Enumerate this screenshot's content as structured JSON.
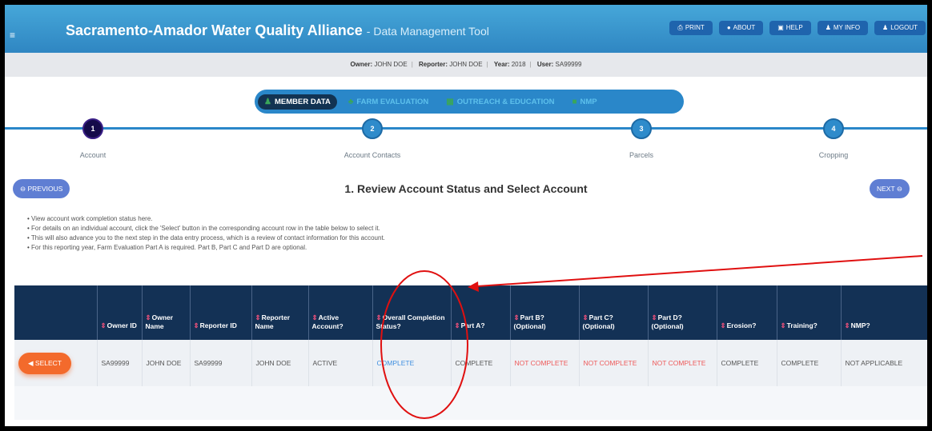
{
  "app": {
    "title": "Sacramento-Amador Water Quality Alliance",
    "subtitle": "- Data Management Tool",
    "menu_icon": "menu-icon",
    "buttons": [
      {
        "label": "PRINT",
        "icon": "printer-icon"
      },
      {
        "label": "ABOUT",
        "icon": "info-icon"
      },
      {
        "label": "HELP",
        "icon": "help-icon"
      },
      {
        "label": "MY INFO",
        "icon": "user-icon"
      },
      {
        "label": "LOGOUT",
        "icon": "logout-icon"
      }
    ]
  },
  "info": {
    "owner_label": "Owner:",
    "owner": "JOHN DOE",
    "reporter_label": "Reporter:",
    "reporter": "JOHN DOE",
    "year_label": "Year:",
    "year": "2018",
    "user_label": "User:",
    "user": "SA99999"
  },
  "phases": [
    {
      "label": "MEMBER DATA",
      "active": true
    },
    {
      "label": "FARM EVALUATION",
      "active": false
    },
    {
      "label": "OUTREACH & EDUCATION",
      "active": false
    },
    {
      "label": "NMP",
      "active": false
    }
  ],
  "steps": [
    {
      "num": "1",
      "label": "Account",
      "active": true
    },
    {
      "num": "2",
      "label": "Account Contacts",
      "active": false
    },
    {
      "num": "3",
      "label": "Parcels",
      "active": false
    },
    {
      "num": "4",
      "label": "Cropping",
      "active": false
    }
  ],
  "nav": {
    "previous": "PREVIOUS",
    "next": "NEXT"
  },
  "section_title": "1. Review Account Status and Select Account",
  "instructions": [
    "View account work completion status here.",
    "For details on an individual account, click the 'Select' button in the corresponding account row in the table below to select it.",
    "This will also advance you to the next step in the data entry process, which is a review of contact information for this account.",
    "For this reporting year, Farm Evaluation Part A is required. Part B, Part C and Part D are optional."
  ],
  "table": {
    "headers": [
      "",
      "Owner ID",
      "Owner Name",
      "Reporter ID",
      "Reporter Name",
      "Active Account?",
      "Overall Completion Status?",
      "Part A?",
      "Part B? (Optional)",
      "Part C? (Optional)",
      "Part D? (Optional)",
      "Erosion?",
      "Training?",
      "NMP?"
    ],
    "row": {
      "select_label": "SELECT",
      "owner_id": "SA99999",
      "owner_name": "JOHN DOE",
      "reporter_id": "SA99999",
      "reporter_name": "JOHN DOE",
      "active": "ACTIVE",
      "overall": "COMPLETE",
      "part_a": "COMPLETE",
      "part_b": "NOT COMPLETE",
      "part_c": "NOT COMPLETE",
      "part_d": "NOT COMPLETE",
      "erosion": "COMPLETE",
      "training": "COMPLETE",
      "nmp": "NOT APPLICABLE"
    }
  },
  "colors": {
    "header_bar": "#2f86c2",
    "table_header": "#133155",
    "select_button": "#f36a2c",
    "not_complete": "#ee5a5a",
    "complete_link": "#3f8fe0",
    "annotation": "#e01010"
  }
}
